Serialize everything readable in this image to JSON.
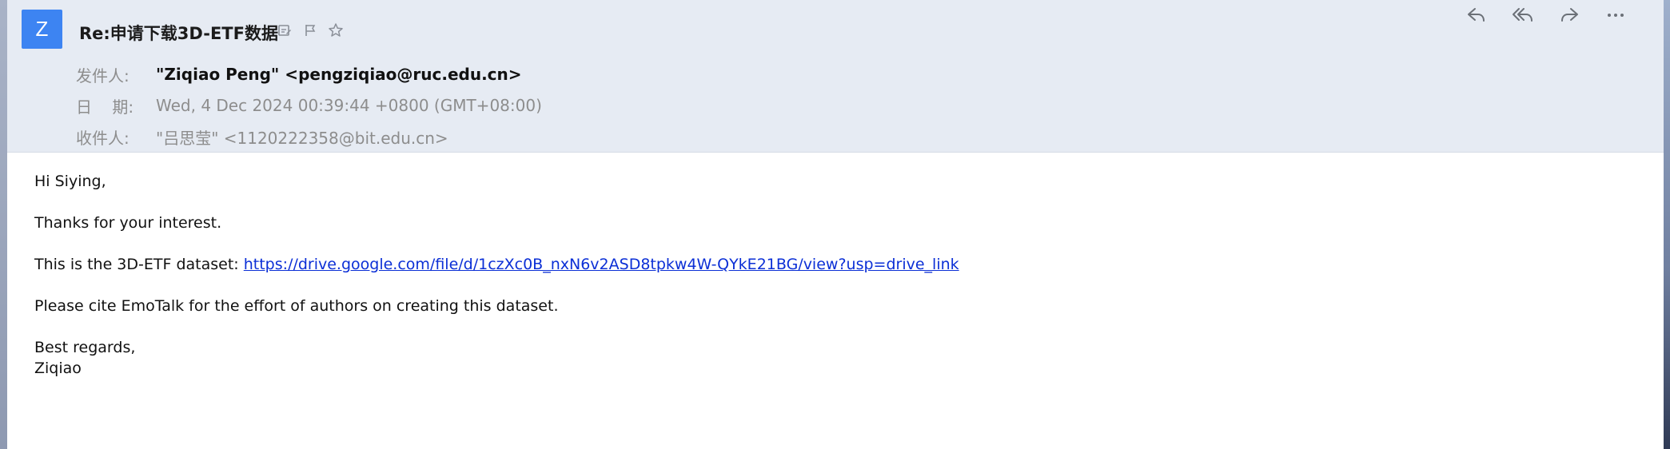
{
  "email": {
    "avatar_letter": "Z",
    "subject": "Re:申请下载3D-ETF数据",
    "from_label": "发件人:",
    "from_value": "\"Ziqiao Peng\" <pengziqiao@ruc.edu.cn>",
    "date_label": "日    期:",
    "date_value": "Wed, 4 Dec 2024 00:39:44 +0800 (GMT+08:00)",
    "to_label": "收件人:",
    "to_value": "\"吕思莹\" <1120222358@bit.edu.cn>",
    "body": {
      "greeting": "Hi Siying,",
      "line1": "Thanks for your interest.",
      "line2_prefix": "This is the 3D-ETF dataset: ",
      "line2_link": "https://drive.google.com/file/d/1czXc0B_nxN6v2ASD8tpkw4W-QYkE21BG/view?usp=drive_link",
      "line3": "Please cite EmoTalk for the effort of authors on creating this dataset.",
      "closing": "Best regards,",
      "signature": "Ziqiao"
    }
  },
  "icons": {
    "subject_icons": [
      "edit-note-icon",
      "flag-icon",
      "star-icon"
    ],
    "toolbar": [
      "reply-icon",
      "reply-all-icon",
      "forward-icon",
      "more-icon"
    ]
  },
  "colors": {
    "avatar": "#3d84f2",
    "header_bg": "#e6ebf3",
    "link": "#0b2fd6"
  }
}
